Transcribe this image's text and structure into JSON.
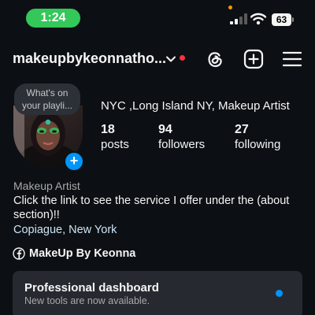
{
  "status_bar": {
    "time": "1:24",
    "battery": "63",
    "colors": {
      "time_pill": "#34c759",
      "recording_dot": "#ff9500"
    },
    "icons": [
      "signal-icon",
      "wifi-icon",
      "battery-icon"
    ]
  },
  "header": {
    "username": "makeupbykeonnatho...",
    "icons": [
      "chevron-down-icon",
      "threads-icon",
      "create-plus-icon",
      "menu-icon"
    ],
    "notification_dot_color": "#ff3040"
  },
  "profile": {
    "note_line1": "What's on",
    "note_line2": "your playli...",
    "name": "NYC ,Long Island NY, Makeup Artist",
    "stats": [
      {
        "value": "18",
        "label": "posts"
      },
      {
        "value": "94",
        "label": "followers"
      },
      {
        "value": "27",
        "label": "following"
      }
    ],
    "category": "Makeup Artist",
    "bio": "Click the link to see the service I offer under the (about section)!!",
    "location": "Copiague, New York",
    "link_text": "MakeUp By Keonna",
    "add_story_glyph": "+"
  },
  "dashboard": {
    "title": "Professional dashboard",
    "subtitle": "New tools are now available.",
    "dot_color": "#0095f6"
  },
  "theme": {
    "background": "#0c1014",
    "accent": "#0095f6"
  }
}
